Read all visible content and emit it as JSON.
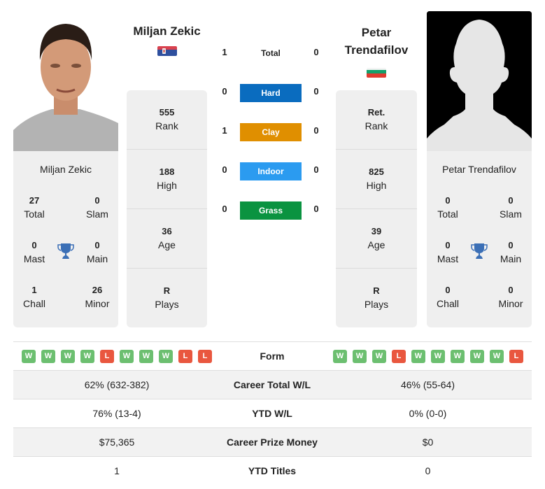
{
  "players": {
    "left": {
      "name": "Miljan Zekic",
      "card_name": "Miljan Zekic",
      "country": "Serbia",
      "flag_icon": "serbia-flag-icon",
      "photo": "player-photo",
      "titles": {
        "total": {
          "value": "27",
          "label": "Total"
        },
        "slam": {
          "value": "0",
          "label": "Slam"
        },
        "mast": {
          "value": "0",
          "label": "Mast"
        },
        "main": {
          "value": "0",
          "label": "Main"
        },
        "chall": {
          "value": "1",
          "label": "Chall"
        },
        "minor": {
          "value": "26",
          "label": "Minor"
        }
      },
      "rank": {
        "value": "555",
        "label": "Rank"
      },
      "high": {
        "value": "188",
        "label": "High"
      },
      "age": {
        "value": "36",
        "label": "Age"
      },
      "plays": {
        "value": "R",
        "label": "Plays"
      }
    },
    "right": {
      "name": "Petar Trendafilov",
      "name_line1": "Petar",
      "name_line2": "Trendafilov",
      "card_name": "Petar Trendafilov",
      "country": "Bulgaria",
      "flag_icon": "bulgaria-flag-icon",
      "photo": "placeholder-silhouette",
      "titles": {
        "total": {
          "value": "0",
          "label": "Total"
        },
        "slam": {
          "value": "0",
          "label": "Slam"
        },
        "mast": {
          "value": "0",
          "label": "Mast"
        },
        "main": {
          "value": "0",
          "label": "Main"
        },
        "chall": {
          "value": "0",
          "label": "Chall"
        },
        "minor": {
          "value": "0",
          "label": "Minor"
        }
      },
      "rank": {
        "value": "Ret.",
        "label": "Rank"
      },
      "high": {
        "value": "825",
        "label": "High"
      },
      "age": {
        "value": "39",
        "label": "Age"
      },
      "plays": {
        "value": "R",
        "label": "Plays"
      }
    }
  },
  "h2h": {
    "total": {
      "label": "Total",
      "left": "1",
      "right": "0"
    },
    "surfaces": [
      {
        "label": "Hard",
        "left": "0",
        "right": "0",
        "color": "#0a6cbf"
      },
      {
        "label": "Clay",
        "left": "1",
        "right": "0",
        "color": "#e08f00"
      },
      {
        "label": "Indoor",
        "left": "0",
        "right": "0",
        "color": "#2b9bf0"
      },
      {
        "label": "Grass",
        "left": "0",
        "right": "0",
        "color": "#0a9340"
      }
    ]
  },
  "comparison": {
    "form": {
      "label": "Form",
      "left": [
        "W",
        "W",
        "W",
        "W",
        "L",
        "W",
        "W",
        "W",
        "L",
        "L"
      ],
      "right": [
        "W",
        "W",
        "W",
        "L",
        "W",
        "W",
        "W",
        "W",
        "W",
        "L"
      ]
    },
    "rows": [
      {
        "label": "Career Total W/L",
        "left": "62% (632-382)",
        "right": "46% (55-64)"
      },
      {
        "label": "YTD W/L",
        "left": "76% (13-4)",
        "right": "0% (0-0)"
      },
      {
        "label": "Career Prize Money",
        "left": "$75,365",
        "right": "$0"
      },
      {
        "label": "YTD Titles",
        "left": "1",
        "right": "0"
      }
    ]
  },
  "colors": {
    "win": "#6cbf70",
    "loss": "#e9573f",
    "trophy": "#3b6fb6",
    "panel": "#efefef"
  }
}
